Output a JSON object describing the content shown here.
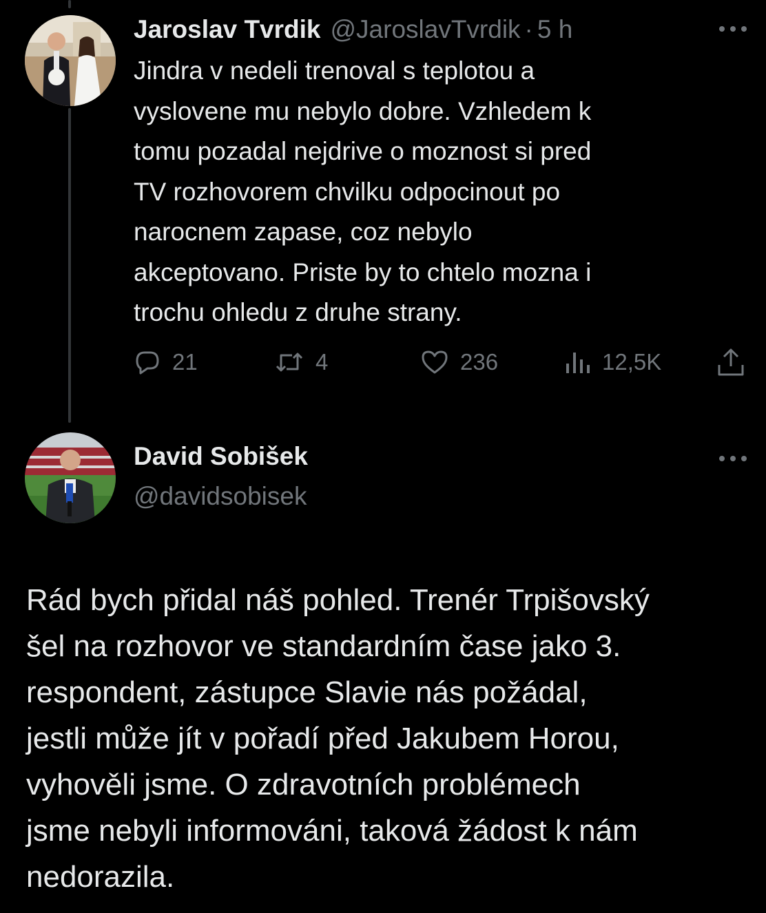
{
  "tweet1": {
    "display_name": "Jaroslav Tvrdik",
    "handle": "@JaroslavTvrdik",
    "separator": "·",
    "time": "5 h",
    "text": "Jindra v nedeli trenoval s teplotou a\nvyslovene mu nebylo dobre. Vzhledem k\ntomu pozadal nejdrive o moznost si pred\nTV rozhovorem chvilku odpocinout po\nnarocnem zapase, coz nebylo\nakceptovano. Priste by to chtelo mozna i\ntrochu ohledu z druhe strany.",
    "actions": {
      "reply_count": "21",
      "retweet_count": "4",
      "like_count": "236",
      "views_count": "12,5K"
    },
    "icons": {
      "reply": "reply-icon",
      "retweet": "retweet-icon",
      "like": "heart-icon",
      "views": "views-icon",
      "share": "share-icon",
      "more": "more-icon"
    }
  },
  "tweet2": {
    "display_name": "David Sobišek",
    "handle": "@davidsobisek",
    "text": "Rád bych přidal náš pohled. Trenér Trpišovský\nšel na rozhovor ve standardním čase jako 3.\nrespondent, zástupce Slavie nás požádal,\njestli může jít v pořadí před Jakubem Horou,\nvyhověli jsme. O zdravotních problémech\njsme nebyli informováni, taková žádost k nám\nnedorazila."
  },
  "colors": {
    "background": "#000000",
    "primary_text": "#e7e9ea",
    "secondary_text": "#71767b",
    "thread_line": "#333639"
  }
}
